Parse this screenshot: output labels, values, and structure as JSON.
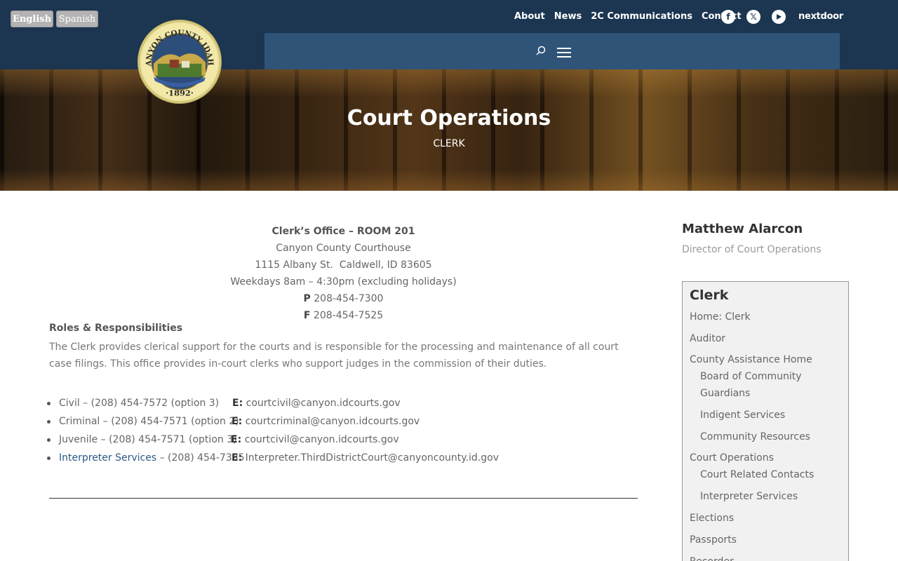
{
  "header": {
    "lang_english": "English",
    "lang_spanish": "Spanish",
    "seal_top_text": "CANYON COUNTY IDAHO",
    "seal_year": "1892",
    "nav": [
      "About",
      "News",
      "2C Communications",
      "Contact"
    ],
    "social_icons": [
      "facebook-icon",
      "x-icon",
      "youtube-icon"
    ],
    "nextdoor": "nextdoor"
  },
  "hero": {
    "title": "Court Operations",
    "subtitle": "CLERK"
  },
  "office": {
    "name": "Clerk’s Office – ROOM 201",
    "building": "Canyon County Courthouse",
    "address": "1115 Albany St.  Caldwell, ID 83605",
    "hours": "Weekdays 8am – 4:30pm (excluding holidays)",
    "phone_label": "P",
    "phone": "208-454-7300",
    "fax_label": "F",
    "fax": "208-454-7525"
  },
  "roles": {
    "heading": "Roles & Responsibilities",
    "text": "The Clerk provides clerical support for the courts and is responsible for the processing and maintenance of all court case filings. This office provides in-court clerks who support judges in the commission of their duties."
  },
  "contacts": [
    {
      "name": "Civil",
      "phone": " – (208) 454-7572 (option 3)",
      "email_label": "E:",
      "email": "courtcivil@canyon.idcourts.gov"
    },
    {
      "name": "Criminal",
      "phone": " – (208) 454-7571 (option 2)",
      "email_label": "E:",
      "email": "courtcriminal@canyon.idcourts.gov"
    },
    {
      "name": "Juvenile",
      "phone": " – (208) 454-7571 (option 3)",
      "email_label": "E:",
      "email": "courtcivil@canyon.idcourts.gov"
    },
    {
      "name": "Interpreter Services",
      "phone": " – (208) 454-7335",
      "email_label": "E:",
      "email": "Interpreter.ThirdDistrictCourt@canyoncounty.id.gov"
    }
  ],
  "sidebar": {
    "person_name": "Matthew Alarcon",
    "person_title": "Director of Court Operations",
    "box_title": "Clerk",
    "items": [
      "Home: Clerk",
      "Auditor",
      "County Assistance Home",
      "Board of Community Guardians",
      "Indigent Services",
      "Community Resources",
      "Court Operations",
      "Court Related Contacts",
      "Interpreter Services",
      "Elections",
      "Passports",
      "Recorder"
    ]
  },
  "colors": {
    "header_bg": "#1c3550",
    "menubar_bg": "#2f5478",
    "link": "#2b5a87"
  }
}
